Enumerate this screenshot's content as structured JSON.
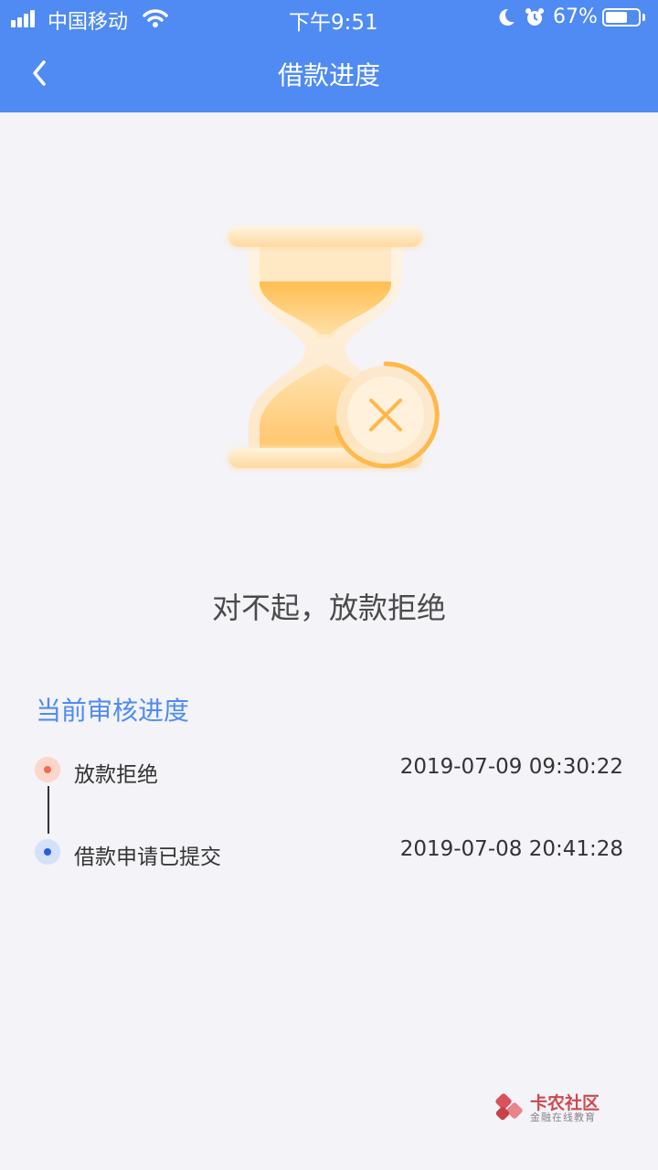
{
  "status_bar": {
    "carrier": "中国移动",
    "time": "下午9:51",
    "battery_percent": "67%",
    "battery_level": 0.67,
    "icons": [
      "signal-icon",
      "wifi-icon",
      "moon-icon",
      "alarm-icon",
      "battery-icon"
    ]
  },
  "header": {
    "title": "借款进度",
    "back_icon": "chevron-left-icon",
    "background_color": "#4f8bf2"
  },
  "result": {
    "illustration": "hourglass-rejected-icon",
    "message": "对不起，放款拒绝"
  },
  "progress": {
    "section_title": "当前审核进度",
    "steps": [
      {
        "label": "放款拒绝",
        "time": "2019-07-09 09:30:22",
        "dot_color": "#f26a4f",
        "dot_bg": "#fcd5cb"
      },
      {
        "label": "借款申请已提交",
        "time": "2019-07-08 20:41:28",
        "dot_color": "#2a5ce0",
        "dot_bg": "#d4e1fb"
      }
    ]
  },
  "watermark": {
    "name": "卡农社区",
    "subtitle": "金融在线教育"
  }
}
